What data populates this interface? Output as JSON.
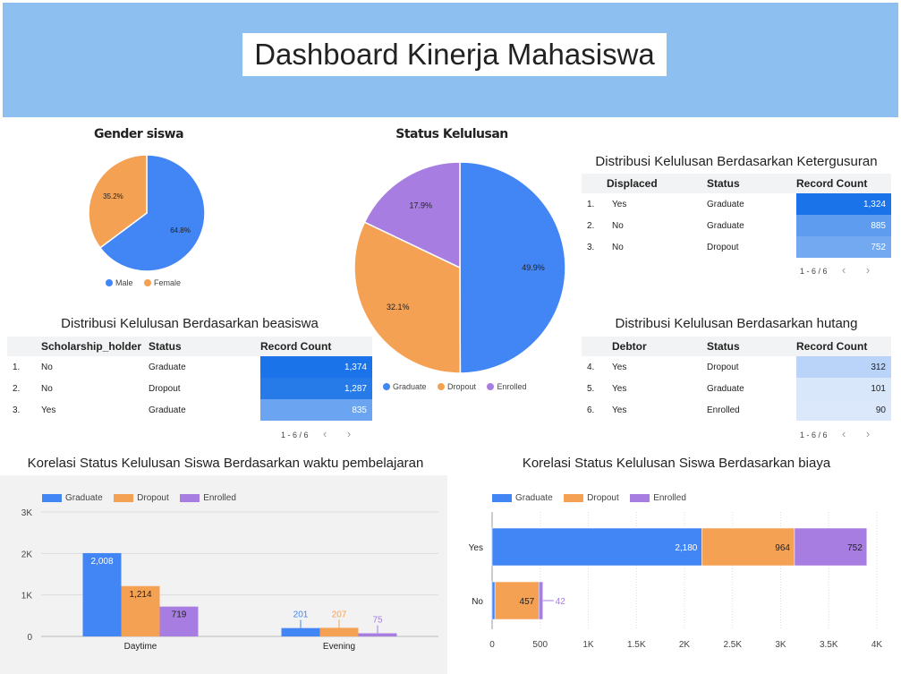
{
  "header": {
    "title": "Dashboard Kinerja Mahasiswa",
    "background": "#8dc0f1"
  },
  "colors": {
    "graduate": "#4285f4",
    "dropout": "#f4a153",
    "enrolled": "#a77de2"
  },
  "gender": {
    "title": "Gender siswa",
    "slices": [
      {
        "label": "Male",
        "value": 64.8,
        "text": "64.8%"
      },
      {
        "label": "Female",
        "value": 35.2,
        "text": "35.2%"
      }
    ],
    "legend": [
      "Male",
      "Female"
    ]
  },
  "status": {
    "title": "Status Kelulusan",
    "slices": [
      {
        "label": "Graduate",
        "value": 49.9,
        "text": "49.9%"
      },
      {
        "label": "Dropout",
        "value": 32.1,
        "text": "32.1%"
      },
      {
        "label": "Enrolled",
        "value": 17.9,
        "text": "17.9%"
      }
    ],
    "legend": [
      "Graduate",
      "Dropout",
      "Enrolled"
    ]
  },
  "table_displaced": {
    "title": "Distribusi Kelulusan Berdasarkan Ketergusuran",
    "headers": [
      "Displaced",
      "Status",
      "Record Count"
    ],
    "rows": [
      {
        "idx": "1.",
        "a": "Yes",
        "b": "Graduate",
        "count": "1,324",
        "value": 1324
      },
      {
        "idx": "2.",
        "a": "No",
        "b": "Graduate",
        "count": "885",
        "value": 885
      },
      {
        "idx": "3.",
        "a": "No",
        "b": "Dropout",
        "count": "752",
        "value": 752
      }
    ],
    "pager": "1 - 6 / 6"
  },
  "table_scholarship": {
    "title": "Distribusi Kelulusan Berdasarkan beasiswa",
    "headers": [
      "Scholarship_holder",
      "Status",
      "Record Count"
    ],
    "rows": [
      {
        "idx": "1.",
        "a": "No",
        "b": "Graduate",
        "count": "1,374",
        "value": 1374
      },
      {
        "idx": "2.",
        "a": "No",
        "b": "Dropout",
        "count": "1,287",
        "value": 1287
      },
      {
        "idx": "3.",
        "a": "Yes",
        "b": "Graduate",
        "count": "835",
        "value": 835
      }
    ],
    "pager": "1 - 6 / 6"
  },
  "table_debtor": {
    "title": "Distribusi Kelulusan Berdasarkan hutang",
    "headers": [
      "Debtor",
      "Status",
      "Record Count"
    ],
    "rows": [
      {
        "idx": "4.",
        "a": "Yes",
        "b": "Dropout",
        "count": "312",
        "value": 312
      },
      {
        "idx": "5.",
        "a": "Yes",
        "b": "Graduate",
        "count": "101",
        "value": 101
      },
      {
        "idx": "6.",
        "a": "Yes",
        "b": "Enrolled",
        "count": "90",
        "value": 90
      }
    ],
    "pager": "1 - 6 / 6"
  },
  "bar_time": {
    "title": "Korelasi Status Kelulusan Siswa Berdasarkan waktu pembelajaran"
  },
  "bar_cost": {
    "title": "Korelasi Status Kelulusan Siswa Berdasarkan biaya"
  },
  "chart_data": [
    {
      "type": "bar",
      "title": "Korelasi Status Kelulusan Siswa Berdasarkan waktu pembelajaran",
      "categories": [
        "Daytime",
        "Evening"
      ],
      "series": [
        {
          "name": "Graduate",
          "values": [
            2008,
            201
          ]
        },
        {
          "name": "Dropout",
          "values": [
            1214,
            207
          ]
        },
        {
          "name": "Enrolled",
          "values": [
            719,
            75
          ]
        }
      ],
      "yticks": [
        "0",
        "1K",
        "2K",
        "3K"
      ],
      "ylim": [
        0,
        3000
      ],
      "legend": "top-left"
    },
    {
      "type": "bar",
      "orientation": "horizontal-stacked",
      "title": "Korelasi Status Kelulusan Siswa Berdasarkan biaya",
      "categories": [
        "Yes",
        "No"
      ],
      "series": [
        {
          "name": "Graduate",
          "values": [
            2180,
            29
          ]
        },
        {
          "name": "Dropout",
          "values": [
            964,
            457
          ]
        },
        {
          "name": "Enrolled",
          "values": [
            752,
            42
          ]
        }
      ],
      "xticks": [
        "0",
        "500",
        "1K",
        "1.5K",
        "2K",
        "2.5K",
        "3K",
        "3.5K",
        "4K"
      ],
      "xlim": [
        0,
        4000
      ],
      "legend": "top-left"
    }
  ]
}
